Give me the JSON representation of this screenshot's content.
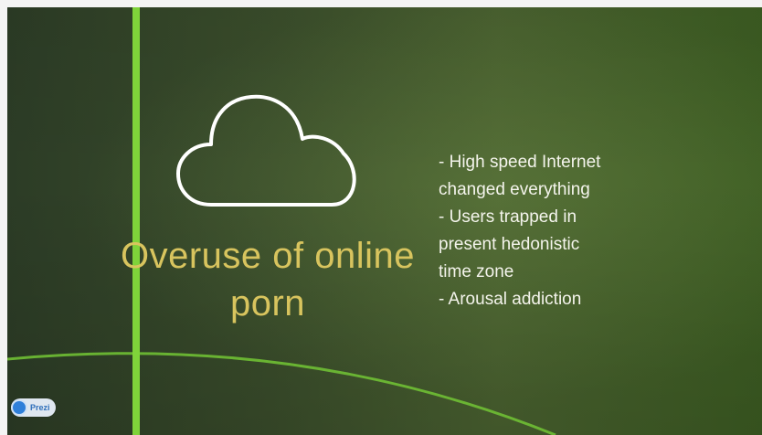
{
  "slide": {
    "title_lines": [
      "Overuse of online",
      "porn"
    ],
    "bullets": [
      "- High speed Internet",
      "changed everything",
      "- Users trapped in",
      "present hedonistic",
      "time zone",
      "- Arousal addiction"
    ],
    "icon": "cloud-icon"
  },
  "branding": {
    "badge_label": "Prezi",
    "icon": "prezi-logo-icon"
  },
  "colors": {
    "title": "#d8c45e",
    "accent_line": "#7fd33a",
    "bullet_text": "#f4f4ec"
  }
}
